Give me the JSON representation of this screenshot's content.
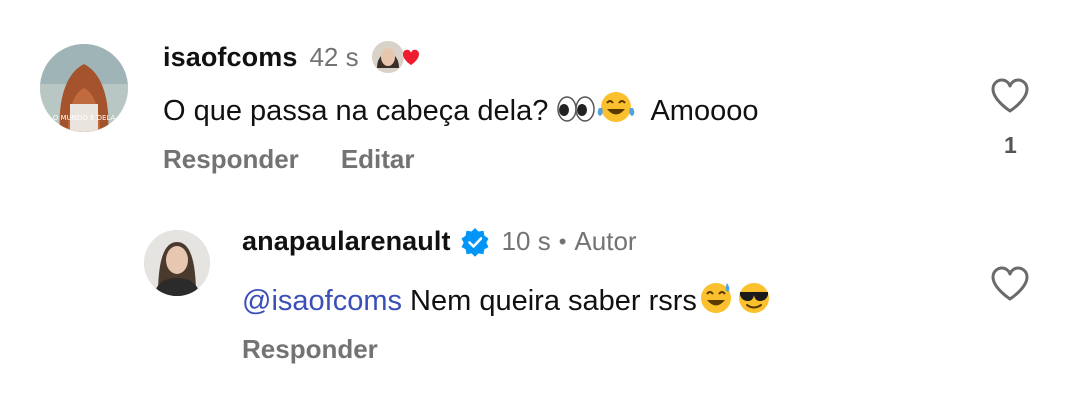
{
  "comments": [
    {
      "username": "isaofcoms",
      "time": "42 s",
      "avatar_caption": "O MUNDO É DELA",
      "text": "O que passa na cabeça dela?",
      "text_tail": "Amoooo",
      "emojis": [
        "eyes-emoji",
        "tears-of-joy-emoji"
      ],
      "actions": [
        "Responder",
        "Editar"
      ],
      "likes": "1",
      "liked_by_author": true
    },
    {
      "username": "anapaularenault",
      "verified": true,
      "time": "10 s",
      "separator": "•",
      "badge": "Autor",
      "mention": "@isaofcoms",
      "text": "Nem queira saber rsrs",
      "emojis": [
        "grinning-sweat-emoji",
        "sunglasses-emoji"
      ],
      "actions": [
        "Responder"
      ]
    }
  ],
  "colors": {
    "mention": "#3b4fb8",
    "verified": "#0095f6",
    "heart_liked": "#ed1c2e",
    "meta": "#737373"
  }
}
